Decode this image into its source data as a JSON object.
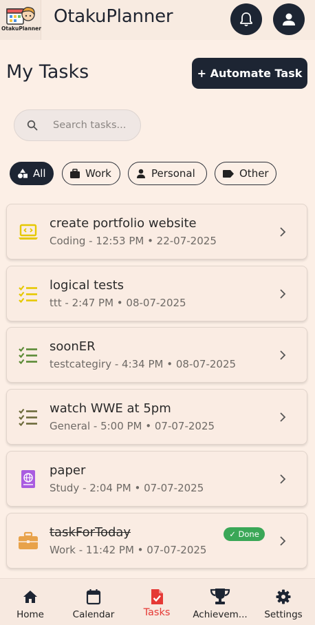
{
  "header": {
    "logo_text": "OtakuPlanner",
    "title": "OtakuPlanner",
    "bell_icon": "bell-icon",
    "profile_icon": "person-icon"
  },
  "page": {
    "title": "My Tasks",
    "automate_label": "+ Automate Task"
  },
  "search": {
    "placeholder": "Search tasks...",
    "value": ""
  },
  "filters": [
    {
      "label": "All",
      "icon": "shapes-icon",
      "active": true
    },
    {
      "label": "Work",
      "icon": "briefcase-icon",
      "active": false
    },
    {
      "label": "Personal",
      "icon": "person-icon",
      "active": false
    },
    {
      "label": "Other",
      "icon": "label-icon",
      "active": false
    }
  ],
  "tasks": [
    {
      "title": "create portfolio website",
      "meta": "Coding - 12:53 PM • 22-07-2025",
      "icon": "code-laptop-icon",
      "icon_color": "#e6c800",
      "done": false
    },
    {
      "title": "logical tests",
      "meta": "ttt - 2:47 PM • 08-07-2025",
      "icon": "checklist-icon",
      "icon_color": "#e6c800",
      "done": false
    },
    {
      "title": "soonER",
      "meta": "testcategiry - 4:34 PM • 08-07-2025",
      "icon": "checklist-icon",
      "icon_color": "#5a8a35",
      "done": false
    },
    {
      "title": "watch WWE at 5pm",
      "meta": "General - 5:00 PM • 07-07-2025",
      "icon": "checklist-icon",
      "icon_color": "#6b6a3a",
      "done": false
    },
    {
      "title": "paper",
      "meta": "Study - 2:04 PM • 07-07-2025",
      "icon": "globe-book-icon",
      "icon_color": "#a95ce0",
      "done": false
    },
    {
      "title": "taskForToday",
      "meta": "Work - 11:42 PM • 07-07-2025",
      "icon": "briefcase-icon",
      "icon_color": "#e8a24a",
      "done": true,
      "badge": "✓ Done"
    }
  ],
  "nav": [
    {
      "label": "Home",
      "icon": "home-icon",
      "active": false
    },
    {
      "label": "Calendar",
      "icon": "calendar-icon",
      "active": false
    },
    {
      "label": "Tasks",
      "icon": "task-icon",
      "active": true
    },
    {
      "label": "Achievem...",
      "icon": "trophy-icon",
      "active": false
    },
    {
      "label": "Settings",
      "icon": "gear-icon",
      "active": false
    }
  ],
  "colors": {
    "background": "#fcefe6",
    "dark": "#1d2533",
    "accent_active": "#e53935",
    "done_badge": "#3aa757"
  }
}
